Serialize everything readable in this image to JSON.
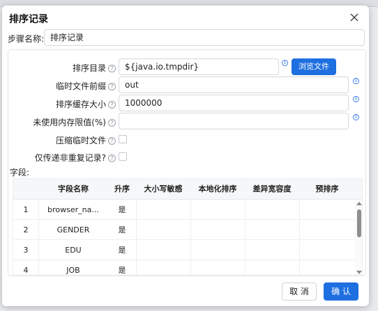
{
  "dialog": {
    "title": "排序记录",
    "step_name_label": "步骤名称:",
    "step_name_value": "排序记录"
  },
  "form": {
    "sort_dir_label": "排序目录",
    "sort_dir_value": "${java.io.tmpdir}",
    "browse_label": "浏览文件",
    "temp_prefix_label": "临时文件前缀",
    "temp_prefix_value": "out",
    "sort_buffer_label": "排序缓存大小",
    "sort_buffer_value": "1000000",
    "free_memory_label": "未使用内存限值(%)",
    "free_memory_value": "",
    "compress_label": "压缩临时文件",
    "compress_checked": false,
    "unique_label": "仅传递非重复记录?",
    "unique_checked": false
  },
  "fields": {
    "label": "字段:",
    "columns": [
      "",
      "字段名称",
      "升序",
      "大小写敏感",
      "本地化排序",
      "差异宽容度",
      "预排序"
    ],
    "rows": [
      {
        "num": "1",
        "name": "browser_na...",
        "asc": "是",
        "case": "",
        "locale": "",
        "collator": "",
        "presorted": ""
      },
      {
        "num": "2",
        "name": "GENDER",
        "asc": "是",
        "case": "",
        "locale": "",
        "collator": "",
        "presorted": ""
      },
      {
        "num": "3",
        "name": "EDU",
        "asc": "是",
        "case": "",
        "locale": "",
        "collator": "",
        "presorted": ""
      },
      {
        "num": "4",
        "name": "JOB",
        "asc": "是",
        "case": "",
        "locale": "",
        "collator": "",
        "presorted": ""
      }
    ]
  },
  "footer": {
    "cancel_label": "取 消",
    "ok_label": "确 认"
  },
  "colors": {
    "primary": "#1e6fe0",
    "info": "#3a7ee4"
  }
}
